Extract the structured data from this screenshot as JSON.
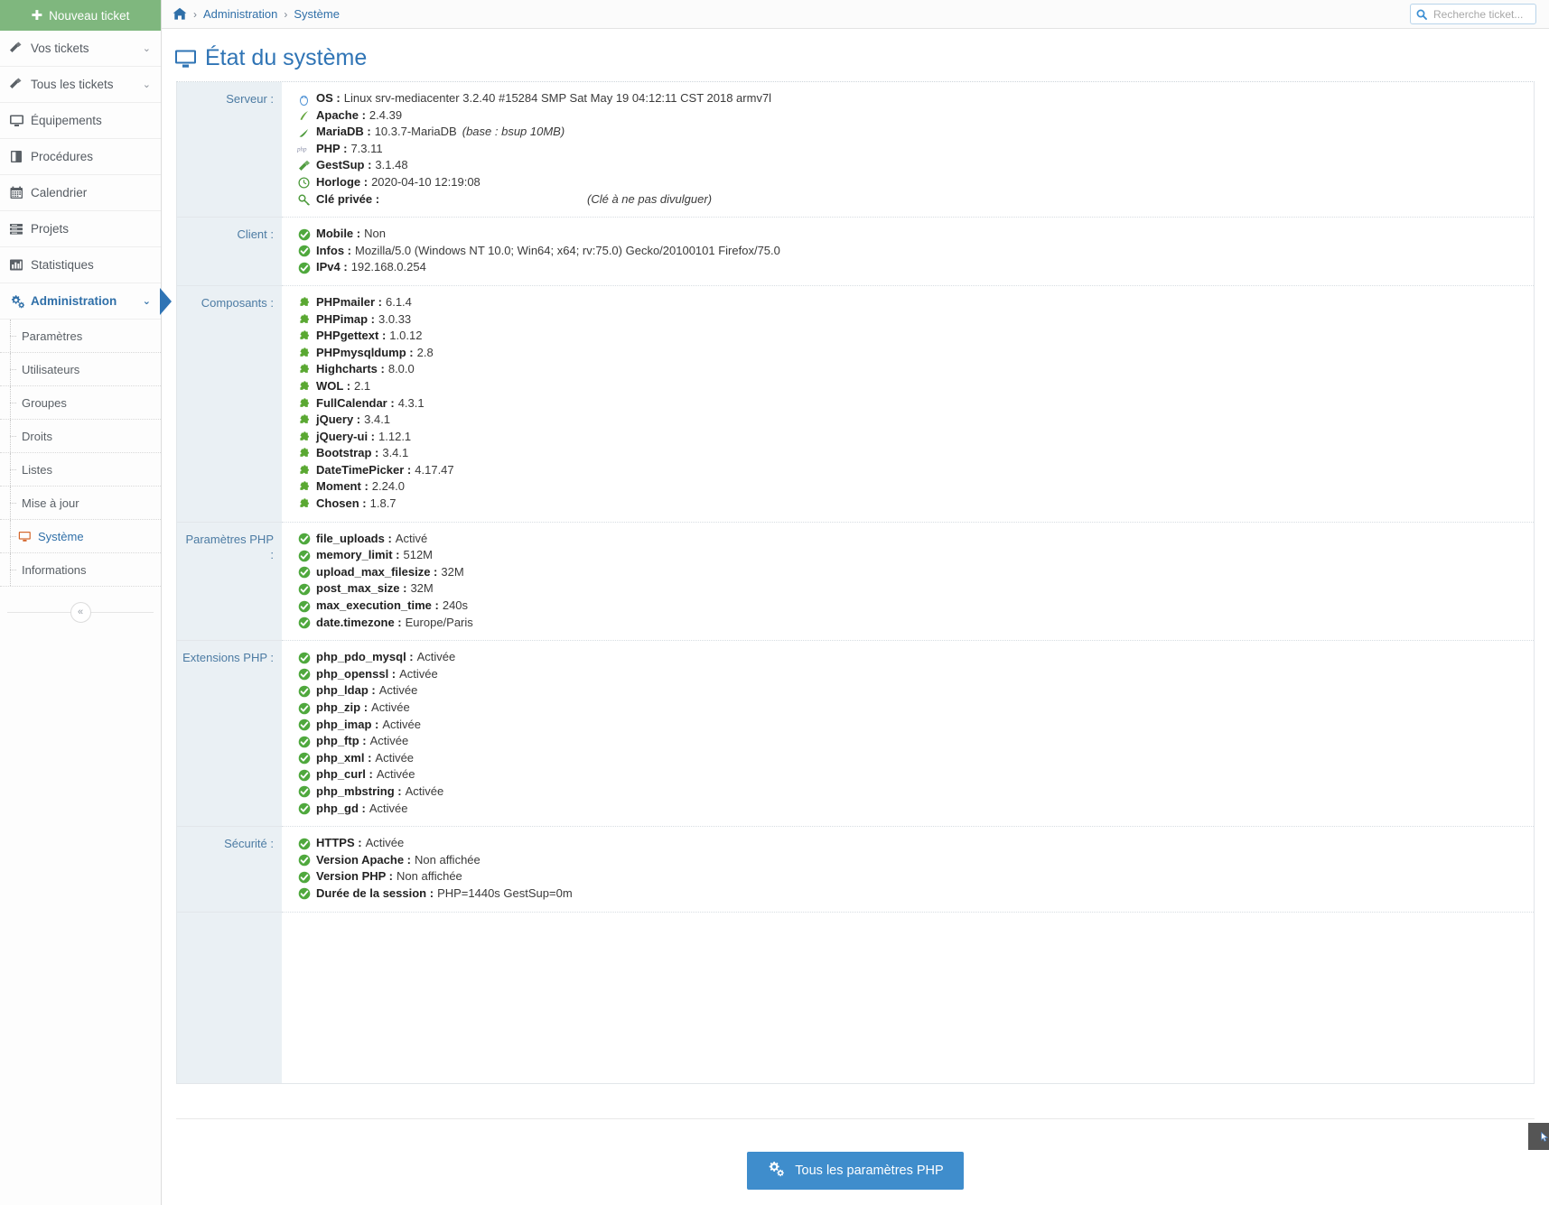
{
  "sidebar": {
    "new_ticket_label": "Nouveau ticket",
    "items": [
      {
        "label": "Vos tickets",
        "icon": "ticket-icon",
        "caret": true
      },
      {
        "label": "Tous les tickets",
        "icon": "ticket-icon",
        "caret": true
      },
      {
        "label": "Équipements",
        "icon": "monitor-icon",
        "caret": false
      },
      {
        "label": "Procédures",
        "icon": "book-icon",
        "caret": false
      },
      {
        "label": "Calendrier",
        "icon": "calendar-icon",
        "caret": false
      },
      {
        "label": "Projets",
        "icon": "list-icon",
        "caret": false
      },
      {
        "label": "Statistiques",
        "icon": "bar-chart-icon",
        "caret": false
      },
      {
        "label": "Administration",
        "icon": "gears-icon",
        "caret": true,
        "active": true
      }
    ],
    "sub_items": [
      {
        "label": "Paramètres"
      },
      {
        "label": "Utilisateurs"
      },
      {
        "label": "Groupes"
      },
      {
        "label": "Droits"
      },
      {
        "label": "Listes"
      },
      {
        "label": "Mise à jour"
      },
      {
        "label": "Système",
        "current": true,
        "icon": "monitor-icon"
      },
      {
        "label": "Informations"
      }
    ],
    "collapse_glyph": "«"
  },
  "topbar": {
    "breadcrumb": {
      "home_icon": "home-icon",
      "sep": "›",
      "items": [
        "Administration",
        "Système"
      ]
    },
    "search": {
      "placeholder": "Recherche ticket...",
      "value": "",
      "icon": "search-icon"
    }
  },
  "page": {
    "title": "État du système",
    "icon": "monitor-icon"
  },
  "sections": [
    {
      "label": "Serveur :",
      "rows": [
        {
          "icon": "linux-icon",
          "key": "OS :",
          "value": "Linux srv-mediacenter 3.2.40 #15284 SMP Sat May 19 04:12:11 CST 2018 armv7l"
        },
        {
          "icon": "feather-icon",
          "key": "Apache :",
          "value": "2.4.39"
        },
        {
          "icon": "seal-icon",
          "key": "MariaDB :",
          "value": "10.3.7-MariaDB",
          "extra": "(base : bsup 10MB)"
        },
        {
          "icon": "php-icon",
          "key": "PHP :",
          "value": "7.3.11"
        },
        {
          "icon": "ticket-icon",
          "key": "GestSup :",
          "value": "3.1.48"
        },
        {
          "icon": "clock-icon",
          "key": "Horloge :",
          "value": "2020-04-10 12:19:08"
        },
        {
          "icon": "key-icon",
          "key": "Clé privée :",
          "value": "",
          "note": "(Clé à ne pas divulguer)"
        }
      ]
    },
    {
      "label": "Client :",
      "rows": [
        {
          "icon": "check-icon",
          "key": "Mobile :",
          "value": "Non"
        },
        {
          "icon": "check-icon",
          "key": "Infos :",
          "value": "Mozilla/5.0 (Windows NT 10.0; Win64; x64; rv:75.0) Gecko/20100101 Firefox/75.0"
        },
        {
          "icon": "check-icon",
          "key": "IPv4 :",
          "value": "192.168.0.254"
        }
      ]
    },
    {
      "label": "Composants :",
      "rows": [
        {
          "icon": "puzzle-icon",
          "key": "PHPmailer :",
          "value": "6.1.4"
        },
        {
          "icon": "puzzle-icon",
          "key": "PHPimap :",
          "value": "3.0.33"
        },
        {
          "icon": "puzzle-icon",
          "key": "PHPgettext :",
          "value": "1.0.12"
        },
        {
          "icon": "puzzle-icon",
          "key": "PHPmysqldump :",
          "value": "2.8"
        },
        {
          "icon": "puzzle-icon",
          "key": "Highcharts :",
          "value": "8.0.0"
        },
        {
          "icon": "puzzle-icon",
          "key": "WOL :",
          "value": "2.1"
        },
        {
          "icon": "puzzle-icon",
          "key": "FullCalendar :",
          "value": "4.3.1"
        },
        {
          "icon": "puzzle-icon",
          "key": "jQuery :",
          "value": "3.4.1"
        },
        {
          "icon": "puzzle-icon",
          "key": "jQuery-ui :",
          "value": "1.12.1"
        },
        {
          "icon": "puzzle-icon",
          "key": "Bootstrap :",
          "value": "3.4.1"
        },
        {
          "icon": "puzzle-icon",
          "key": "DateTimePicker :",
          "value": "4.17.47"
        },
        {
          "icon": "puzzle-icon",
          "key": "Moment :",
          "value": "2.24.0"
        },
        {
          "icon": "puzzle-icon",
          "key": "Chosen :",
          "value": "1.8.7"
        }
      ]
    },
    {
      "label": "Paramètres PHP :",
      "rows": [
        {
          "icon": "check-icon",
          "key": "file_uploads :",
          "value": "Activé"
        },
        {
          "icon": "check-icon",
          "key": "memory_limit :",
          "value": "512M"
        },
        {
          "icon": "check-icon",
          "key": "upload_max_filesize :",
          "value": "32M"
        },
        {
          "icon": "check-icon",
          "key": "post_max_size :",
          "value": "32M"
        },
        {
          "icon": "check-icon",
          "key": "max_execution_time :",
          "value": "240s"
        },
        {
          "icon": "check-icon",
          "key": "date.timezone :",
          "value": "Europe/Paris"
        }
      ]
    },
    {
      "label": "Extensions PHP :",
      "rows": [
        {
          "icon": "check-icon",
          "key": "php_pdo_mysql :",
          "value": "Activée"
        },
        {
          "icon": "check-icon",
          "key": "php_openssl :",
          "value": "Activée"
        },
        {
          "icon": "check-icon",
          "key": "php_ldap :",
          "value": "Activée"
        },
        {
          "icon": "check-icon",
          "key": "php_zip :",
          "value": "Activée"
        },
        {
          "icon": "check-icon",
          "key": "php_imap :",
          "value": "Activée"
        },
        {
          "icon": "check-icon",
          "key": "php_ftp :",
          "value": "Activée"
        },
        {
          "icon": "check-icon",
          "key": "php_xml :",
          "value": "Activée"
        },
        {
          "icon": "check-icon",
          "key": "php_curl :",
          "value": "Activée"
        },
        {
          "icon": "check-icon",
          "key": "php_mbstring :",
          "value": "Activée"
        },
        {
          "icon": "check-icon",
          "key": "php_gd :",
          "value": "Activée"
        }
      ]
    },
    {
      "label": "Sécurité :",
      "rows": [
        {
          "icon": "check-icon",
          "key": "HTTPS :",
          "value": "Activée"
        },
        {
          "icon": "check-icon",
          "key": "Version Apache :",
          "value": "Non affichée"
        },
        {
          "icon": "check-icon",
          "key": "Version PHP :",
          "value": "Non affichée"
        },
        {
          "icon": "check-icon",
          "key": "Durée de la session :",
          "value": "PHP=1440s GestSup=0m"
        }
      ]
    }
  ],
  "footer": {
    "php_button_label": "Tous les paramètres PHP",
    "php_button_icon": "gears-icon"
  },
  "colors": {
    "brand_blue": "#2f74b5",
    "green_button": "#7fb77e",
    "label_bg": "#eaf0f4",
    "label_text": "#4c7ba3",
    "success_green": "#5cb85c",
    "primary_button": "#3f8dcc"
  }
}
